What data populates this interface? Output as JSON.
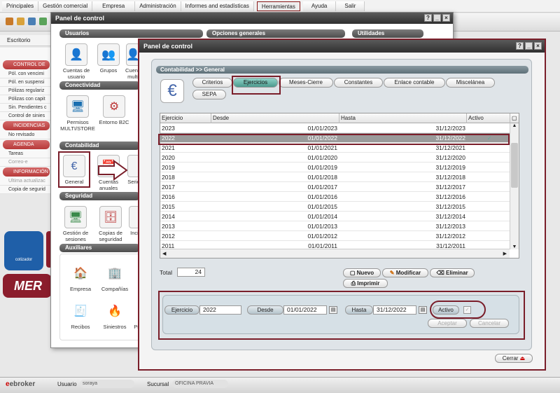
{
  "menu": [
    "Principales",
    "Gestión comercial",
    "Empresa",
    "Administración",
    "Informes and estadísticas",
    "Herramientas",
    "Ayuda",
    "Salir"
  ],
  "sidebar": {
    "escritorio": "Escritorio",
    "sections": [
      {
        "title": "CONTROL DE C",
        "items": [
          "Pól. con vencimi",
          "Pól. en suspensi",
          "Pólizas regulariz",
          "Pólizas con capit",
          "Sin. Pendientes c",
          "Control de sinies"
        ]
      },
      {
        "title": "INCIDENCIAS DE",
        "items": [
          "No revisado"
        ]
      },
      {
        "title": "AGENDA",
        "items": [
          "Tareas",
          "Correo-e"
        ]
      },
      {
        "title": "INFORMACIÓN",
        "items": [
          "Ultima actualizac",
          "Copia de segurid"
        ]
      }
    ],
    "tiles": [
      {
        "label": "cotizador",
        "color": "#1f5fa8"
      },
      {
        "label": "MER",
        "color": "#8b1d2c"
      }
    ]
  },
  "panel_back": {
    "title": "Panel de control",
    "sections": {
      "usuarios": "Usuarios",
      "opciones": "Opciones generales",
      "utilidades": "Utilidades",
      "conectividad": "Conectividad",
      "contabilidad": "Contabilidad",
      "seguridad": "Seguridad",
      "auxiliares": "Auxiliares"
    },
    "icons": {
      "cuentas_usuario": "Cuentas de usuario",
      "grupos": "Grupos",
      "cuentas_multi": "Cuentas multi",
      "permisos": "Permisos MULTI/STORE",
      "entorno_b2c": "Entorno B2C",
      "general": "General",
      "cuentas_anuales": "Cuentas anuales",
      "series": "Serie",
      "gestion_sesiones": "Gestión de sesiones",
      "copias": "Copias de seguridad",
      "inci": "Inci",
      "empresa": "Empresa",
      "companias": "Compañías",
      "recibos": "Recibos",
      "siniestros": "Siniestros",
      "pr": "Pr"
    }
  },
  "panel_front": {
    "title": "Panel de control",
    "breadcrumb": "Contabilidad >> General",
    "tabs": [
      "Criterios",
      "Ejercicios",
      "Meses-Cierre",
      "Constantes",
      "Enlace contable",
      "Miscelánea",
      "SEPA"
    ],
    "active_tab": "Ejercicios",
    "columns": [
      "Ejercicio",
      "Desde",
      "Hasta",
      "Activo"
    ],
    "rows": [
      {
        "ejercicio": "2023",
        "desde": "01/01/2023",
        "hasta": "31/12/2023",
        "activo": ""
      },
      {
        "ejercicio": "2022",
        "desde": "01/01/2022",
        "hasta": "31/12/2022",
        "activo": "✓"
      },
      {
        "ejercicio": "2021",
        "desde": "01/01/2021",
        "hasta": "31/12/2021",
        "activo": ""
      },
      {
        "ejercicio": "2020",
        "desde": "01/01/2020",
        "hasta": "31/12/2020",
        "activo": ""
      },
      {
        "ejercicio": "2019",
        "desde": "01/01/2019",
        "hasta": "31/12/2019",
        "activo": ""
      },
      {
        "ejercicio": "2018",
        "desde": "01/01/2018",
        "hasta": "31/12/2018",
        "activo": ""
      },
      {
        "ejercicio": "2017",
        "desde": "01/01/2017",
        "hasta": "31/12/2017",
        "activo": ""
      },
      {
        "ejercicio": "2016",
        "desde": "01/01/2016",
        "hasta": "31/12/2016",
        "activo": ""
      },
      {
        "ejercicio": "2015",
        "desde": "01/01/2015",
        "hasta": "31/12/2015",
        "activo": ""
      },
      {
        "ejercicio": "2014",
        "desde": "01/01/2014",
        "hasta": "31/12/2014",
        "activo": ""
      },
      {
        "ejercicio": "2013",
        "desde": "01/01/2013",
        "hasta": "31/12/2013",
        "activo": ""
      },
      {
        "ejercicio": "2012",
        "desde": "01/01/2012",
        "hasta": "31/12/2012",
        "activo": ""
      },
      {
        "ejercicio": "2011",
        "desde": "01/01/2011",
        "hasta": "31/12/2011",
        "activo": ""
      }
    ],
    "total_label": "Total",
    "total_value": "24",
    "buttons": {
      "nuevo": "Nuevo",
      "modificar": "Modificar",
      "eliminar": "Eliminar",
      "imprimir": "Imprimir"
    },
    "form": {
      "ejercicio_label": "Ejercicio",
      "ejercicio_value": "2022",
      "desde_label": "Desde",
      "desde_value": "01/01/2022",
      "hasta_label": "Hasta",
      "hasta_value": "31/12/2022",
      "activo_label": "Activo",
      "aceptar": "Aceptar",
      "cancelar": "Cancelar"
    },
    "cerrar": "Cerrar"
  },
  "footer": {
    "brand": "ebroker",
    "usuario_label": "Usuario",
    "usuario_value": "soraya",
    "sucursal_label": "Sucursal",
    "sucursal_value": "OFICINA PRAVIA"
  },
  "colors": {
    "highlight": "#7a1e2a",
    "accent_tab": "#4c9a8e",
    "section_header": "#b83a3a"
  }
}
